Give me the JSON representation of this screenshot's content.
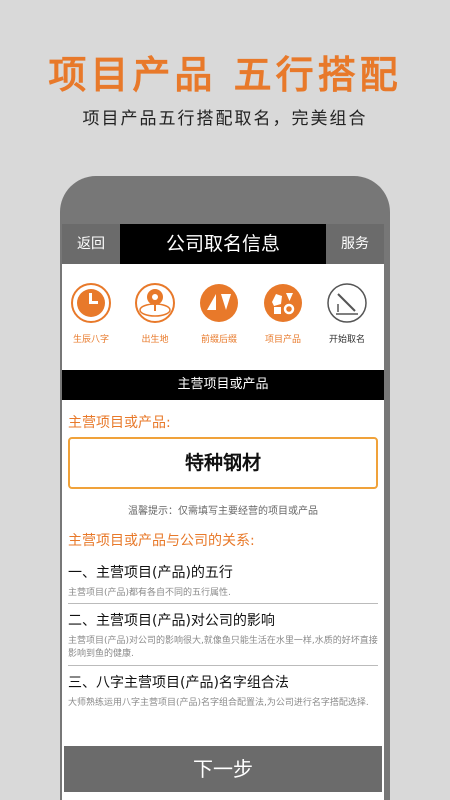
{
  "promo": {
    "title": "项目产品  五行搭配",
    "subtitle": "项目产品五行搭配取名，完美组合"
  },
  "topbar": {
    "back": "返回",
    "title": "公司取名信息",
    "service": "服务"
  },
  "steps": [
    {
      "label": "生辰八字",
      "icon": "clock-icon"
    },
    {
      "label": "出生地",
      "icon": "location-pin-icon"
    },
    {
      "label": "前缀后缀",
      "icon": "triangles-icon"
    },
    {
      "label": "项目产品",
      "icon": "shapes-icon"
    },
    {
      "label": "开始取名",
      "icon": "pen-icon"
    }
  ],
  "section_title": "主营项目或产品",
  "form": {
    "label": "主营项目或产品:",
    "value": "特种钢材",
    "hint": "温馨提示：仅需填写主要经营的项目或产品"
  },
  "relation_title": "主营项目或产品与公司的关系:",
  "items": [
    {
      "head": "一、主营项目(产品)的五行",
      "desc": "主营项目(产品)都有各自不同的五行属性."
    },
    {
      "head": "二、主营项目(产品)对公司的影响",
      "desc": "主营项目(产品)对公司的影响很大,就像鱼只能生活在水里一样,水质的好坏直接影响到鱼的健康."
    },
    {
      "head": "三、八字主营项目(产品)名字组合法",
      "desc": "大师熟练运用八字主营项目(产品)名字组合配置法,为公司进行名字搭配选择."
    }
  ],
  "next_button": "下一步",
  "colors": {
    "accent": "#e8792a",
    "bar": "#000000",
    "button": "#6b6b6b"
  }
}
